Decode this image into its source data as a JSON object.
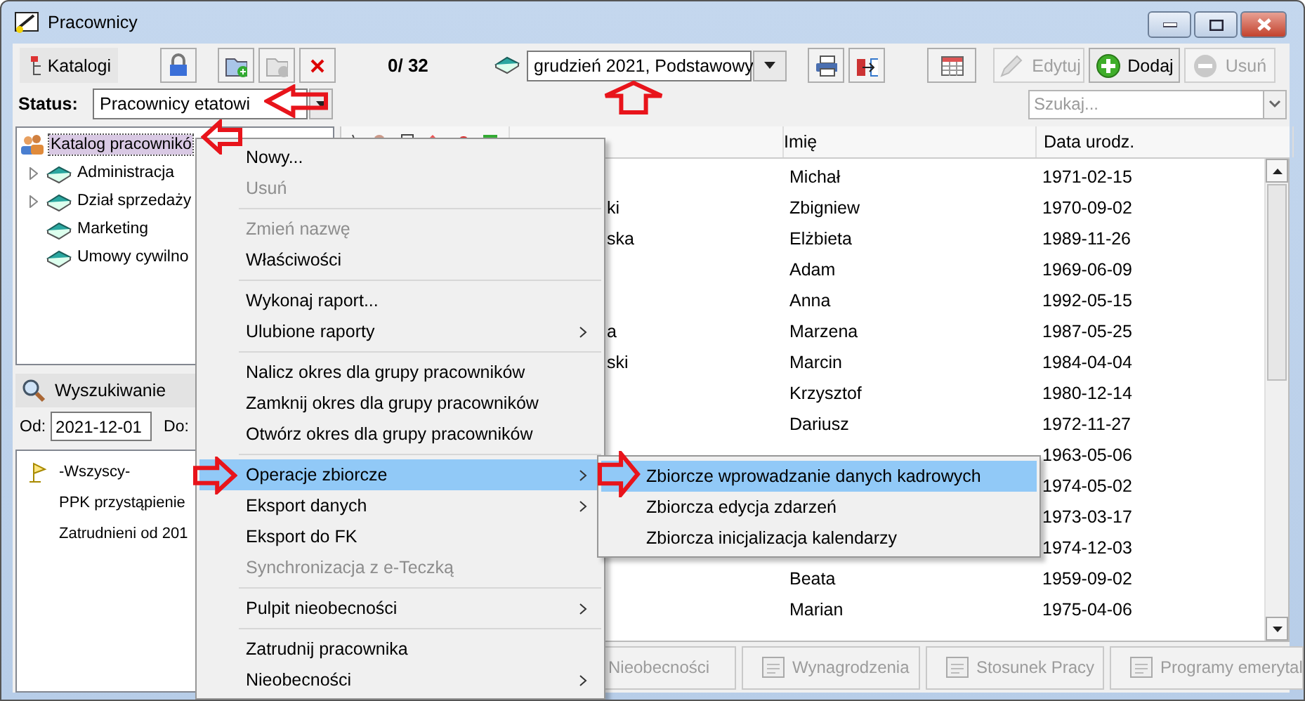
{
  "window": {
    "title": "Pracownicy"
  },
  "toolbar": {
    "catalogs": "Katalogi",
    "counter": "0/ 32",
    "period": "grudzień 2021, Podstawowy",
    "actions": [
      {
        "kind": "edit",
        "label": "Edytuj",
        "disabled": true
      },
      {
        "kind": "add",
        "label": "Dodaj",
        "disabled": false
      },
      {
        "kind": "remove",
        "label": "Usuń",
        "disabled": true
      }
    ]
  },
  "status": {
    "label": "Status:",
    "value": "Pracownicy etatowi"
  },
  "search": {
    "placeholder": "Szukaj..."
  },
  "tree": [
    {
      "label": "Katalog pracownikó",
      "selected": true,
      "children": [
        {
          "label": "Administracja",
          "selected": false,
          "expandable": true
        },
        {
          "label": "Dział sprzedaży",
          "selected": false,
          "expandable": true
        },
        {
          "label": "Marketing",
          "selected": false,
          "expandable": false
        },
        {
          "label": "Umowy cywilno",
          "selected": false,
          "expandable": false
        }
      ]
    }
  ],
  "finder": {
    "title": "Wyszukiwanie",
    "from_label": "Od:",
    "from": "2021-12-01",
    "to_label": "Do:",
    "items": [
      {
        "label": "-Wszyscy-",
        "flag": true
      },
      {
        "label": "PPK przystąpienie",
        "flag": false
      },
      {
        "label": "Zatrudnieni od 201",
        "flag": false
      }
    ]
  },
  "table": {
    "columns": [
      "Imię",
      "Data urodz."
    ],
    "rows": [
      {
        "first_name": "Michał",
        "birth_date": "1971-02-15"
      },
      {
        "surname": "ki",
        "first_name": "Zbigniew",
        "birth_date": "1970-09-02"
      },
      {
        "surname": "ska",
        "first_name": "Elżbieta",
        "birth_date": "1989-11-26"
      },
      {
        "first_name": "Adam",
        "birth_date": "1969-06-09"
      },
      {
        "first_name": "Anna",
        "birth_date": "1992-05-15"
      },
      {
        "surname": "a",
        "first_name": "Marzena",
        "birth_date": "1987-05-25"
      },
      {
        "surname": "ski",
        "first_name": "Marcin",
        "birth_date": "1984-04-04"
      },
      {
        "first_name": "Krzysztof",
        "birth_date": "1980-12-14"
      },
      {
        "first_name": "Dariusz",
        "birth_date": "1972-11-27"
      },
      {
        "birth_date": "1963-05-06"
      },
      {
        "birth_date": "1974-05-02"
      },
      {
        "birth_date": "1973-03-17"
      },
      {
        "birth_date": "1974-12-03"
      },
      {
        "first_name": "Beata",
        "birth_date": "1959-09-02"
      },
      {
        "first_name": "Marian",
        "birth_date": "1975-04-06"
      }
    ]
  },
  "bottom_tabs": [
    {
      "label": "Nieobecności",
      "disabled": true
    },
    {
      "label": "Wynagrodzenia",
      "disabled": true
    },
    {
      "label": "Stosunek Pracy",
      "disabled": true
    },
    {
      "label": "Programy emerytal",
      "disabled": true
    }
  ],
  "context_menu": {
    "items": [
      {
        "kind": "item",
        "label": "Nowy...",
        "disabled": false,
        "selected": false,
        "submenu": false
      },
      {
        "kind": "item",
        "label": "Usuń",
        "disabled": true,
        "selected": false,
        "submenu": false
      },
      {
        "kind": "separator"
      },
      {
        "kind": "item",
        "label": "Zmień nazwę",
        "disabled": true,
        "selected": false,
        "submenu": false
      },
      {
        "kind": "item",
        "label": "Właściwości",
        "disabled": false,
        "selected": false,
        "submenu": false
      },
      {
        "kind": "separator"
      },
      {
        "kind": "item",
        "label": "Wykonaj raport...",
        "disabled": false,
        "selected": false,
        "submenu": false
      },
      {
        "kind": "item",
        "label": "Ulubione raporty",
        "disabled": false,
        "selected": false,
        "submenu": true
      },
      {
        "kind": "separator"
      },
      {
        "kind": "item",
        "label": "Nalicz okres dla grupy pracowników",
        "disabled": false,
        "selected": false,
        "submenu": false
      },
      {
        "kind": "item",
        "label": "Zamknij okres dla grupy pracowników",
        "disabled": false,
        "selected": false,
        "submenu": false
      },
      {
        "kind": "item",
        "label": "Otwórz okres dla grupy pracowników",
        "disabled": false,
        "selected": false,
        "submenu": false
      },
      {
        "kind": "separator"
      },
      {
        "kind": "item",
        "label": "Operacje zbiorcze",
        "disabled": false,
        "selected": true,
        "submenu": true
      },
      {
        "kind": "item",
        "label": "Eksport danych",
        "disabled": false,
        "selected": false,
        "submenu": true
      },
      {
        "kind": "item",
        "label": "Eksport do FK",
        "disabled": false,
        "selected": false,
        "submenu": false
      },
      {
        "kind": "item",
        "label": "Synchronizacja z e-Teczką",
        "disabled": true,
        "selected": false,
        "submenu": false
      },
      {
        "kind": "separator"
      },
      {
        "kind": "item",
        "label": "Pulpit nieobecności",
        "disabled": false,
        "selected": false,
        "submenu": true
      },
      {
        "kind": "separator"
      },
      {
        "kind": "item",
        "label": "Zatrudnij pracownika",
        "disabled": false,
        "selected": false,
        "submenu": false
      },
      {
        "kind": "item",
        "label": "Nieobecności",
        "disabled": false,
        "selected": false,
        "submenu": true
      }
    ]
  },
  "submenu": {
    "items": [
      {
        "label": "Zbiorcze wprowadzanie danych kadrowych",
        "selected": true
      },
      {
        "label": "Zbiorcza edycja zdarzeń",
        "selected": false
      },
      {
        "label": "Zbiorcza inicjalizacja kalendarzy",
        "selected": false
      }
    ]
  }
}
